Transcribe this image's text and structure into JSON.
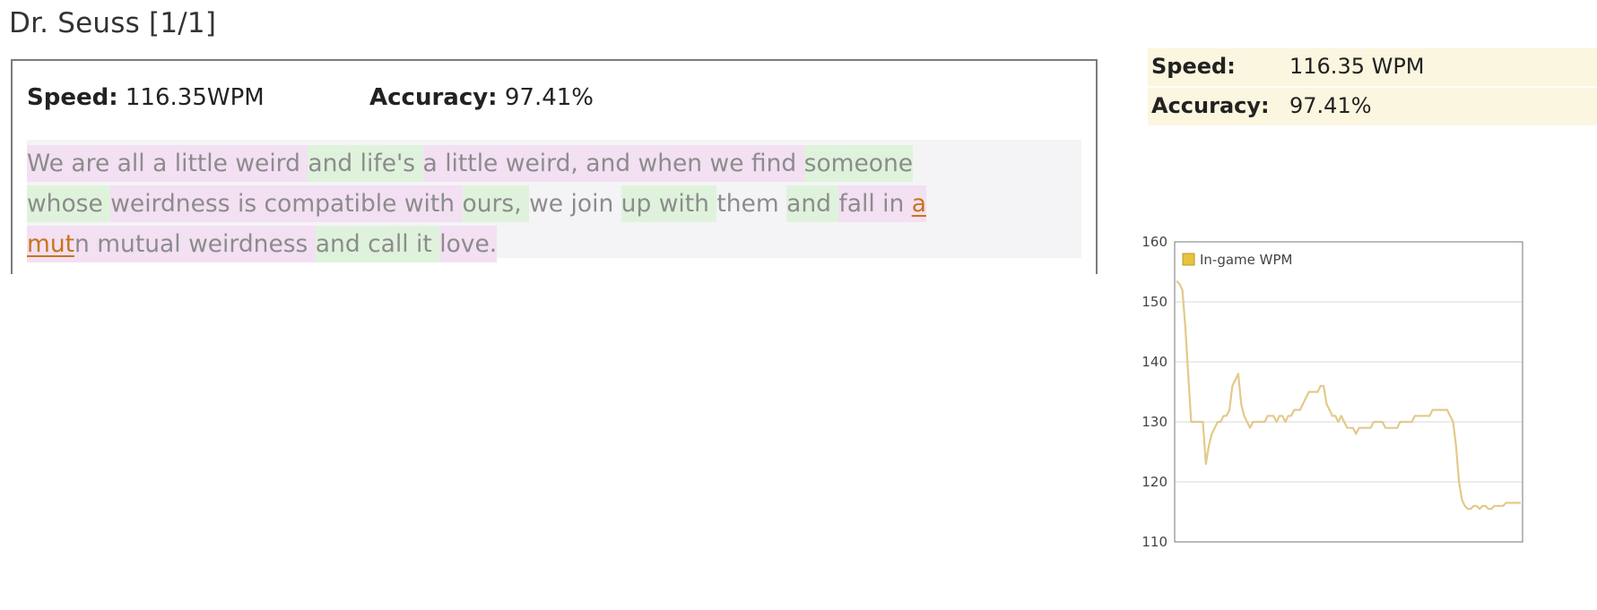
{
  "page": {
    "title": "Dr. Seuss [1/1]"
  },
  "result": {
    "speed_label": "Speed:",
    "speed_value": "116.35WPM",
    "accuracy_label": "Accuracy:",
    "accuracy_value": "97.41%",
    "passage": [
      {
        "t": "We ",
        "c": "p"
      },
      {
        "t": "are ",
        "c": "p"
      },
      {
        "t": "all ",
        "c": "p"
      },
      {
        "t": "a ",
        "c": "p"
      },
      {
        "t": "little ",
        "c": "p"
      },
      {
        "t": "weird ",
        "c": "p"
      },
      {
        "t": "and ",
        "c": "g"
      },
      {
        "t": "life's ",
        "c": "g"
      },
      {
        "t": "a ",
        "c": "p"
      },
      {
        "t": "little ",
        "c": "p"
      },
      {
        "t": "weird, ",
        "c": "p"
      },
      {
        "t": "and ",
        "c": "p"
      },
      {
        "t": "when ",
        "c": "p"
      },
      {
        "t": "we ",
        "c": "p"
      },
      {
        "t": "find ",
        "c": "p"
      },
      {
        "t": "someone",
        "c": "g"
      },
      {
        "t": "\n",
        "c": "br"
      },
      {
        "t": "whose ",
        "c": "g"
      },
      {
        "t": "weirdness ",
        "c": "p"
      },
      {
        "t": "is ",
        "c": "p"
      },
      {
        "t": "compatible ",
        "c": "p"
      },
      {
        "t": "with ",
        "c": "p"
      },
      {
        "t": "ours, ",
        "c": "g"
      },
      {
        "t": "we ",
        "c": "n"
      },
      {
        "t": "join ",
        "c": "n"
      },
      {
        "t": "up ",
        "c": "g"
      },
      {
        "t": "with ",
        "c": "g"
      },
      {
        "t": "them ",
        "c": "n"
      },
      {
        "t": "and ",
        "c": "g"
      },
      {
        "t": "fall ",
        "c": "p"
      },
      {
        "t": "in ",
        "c": "p"
      },
      {
        "t": "a",
        "c": "err"
      },
      {
        "t": "\n",
        "c": "br"
      },
      {
        "t": "mut",
        "c": "err"
      },
      {
        "t": "n ",
        "c": "p"
      },
      {
        "t": "mutual ",
        "c": "p"
      },
      {
        "t": "weirdness ",
        "c": "p"
      },
      {
        "t": "and ",
        "c": "g"
      },
      {
        "t": "call ",
        "c": "g"
      },
      {
        "t": "it ",
        "c": "g"
      },
      {
        "t": "love.",
        "c": "p"
      }
    ]
  },
  "side": {
    "speed_label": "Speed:",
    "speed_value": "116.35 WPM",
    "accuracy_label": "Accuracy:",
    "accuracy_value": "97.41%"
  },
  "chart_data": {
    "type": "line",
    "title": "",
    "xlabel": "",
    "ylabel": "",
    "ylim": [
      110,
      160
    ],
    "yticks": [
      110,
      120,
      130,
      140,
      150,
      160
    ],
    "grid": true,
    "legend": "top-left",
    "series": [
      {
        "name": "In-game WPM",
        "color": "#e3c98a",
        "values": [
          153.5,
          153,
          152,
          146,
          138,
          130,
          130,
          130,
          130,
          130,
          123,
          126,
          128,
          129,
          130,
          130,
          131,
          131,
          132,
          136,
          137,
          138,
          133,
          131,
          130,
          129,
          130,
          130,
          130,
          130,
          130,
          131,
          131,
          131,
          130,
          131,
          131,
          130,
          131,
          131,
          132,
          132,
          132,
          133,
          134,
          135,
          135,
          135,
          135,
          136,
          136,
          133,
          132,
          131,
          131,
          130,
          131,
          130,
          129,
          129,
          129,
          128,
          129,
          129,
          129,
          129,
          129,
          130,
          130,
          130,
          130,
          129,
          129,
          129,
          129,
          129,
          130,
          130,
          130,
          130,
          130,
          131,
          131,
          131,
          131,
          131,
          131,
          132,
          132,
          132,
          132,
          132,
          132,
          131,
          130,
          126,
          120,
          117,
          116,
          115.5,
          115.5,
          116,
          116,
          115.5,
          116,
          116,
          115.5,
          115.5,
          116,
          116,
          116,
          116,
          116.5,
          116.5,
          116.5,
          116.5,
          116.5,
          116.5
        ]
      }
    ],
    "colors": {
      "line": "#e3c98a",
      "legend_swatch": "#e8c23a",
      "grid": "#d8d8d8",
      "frame": "#777777"
    }
  },
  "colors": {
    "highlight_pink": "#f3e0f3",
    "highlight_green": "#dff3dc",
    "error_text": "#c8741a",
    "side_bg": "#fbf6df"
  }
}
